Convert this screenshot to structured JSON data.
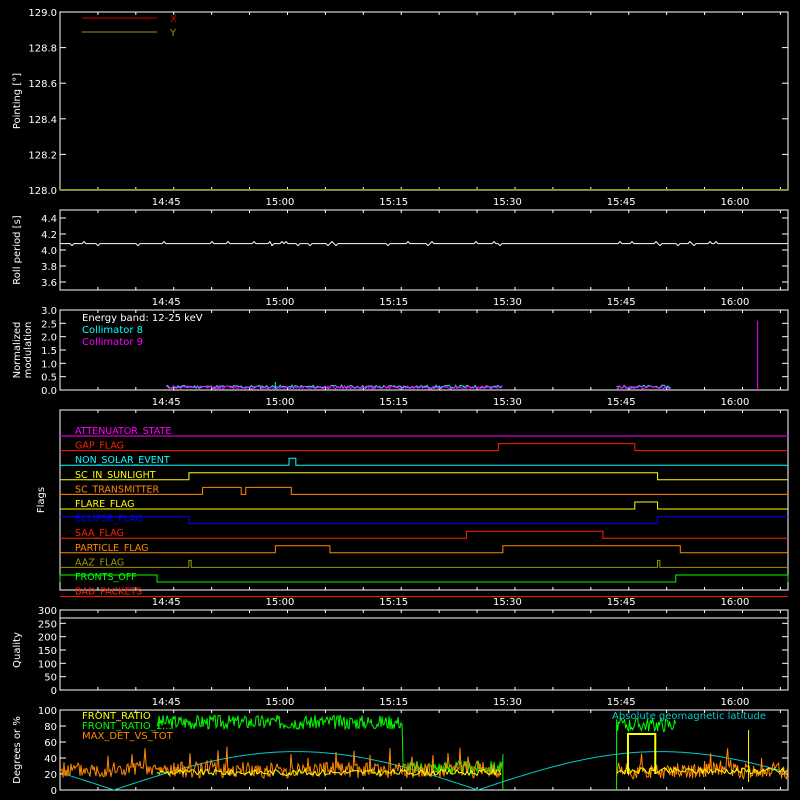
{
  "time_axis": {
    "ticks": [
      "14:45",
      "15:00",
      "15:15",
      "15:30",
      "15:45",
      "16:00"
    ],
    "tick_hours": [
      14.75,
      15.0,
      15.25,
      15.5,
      15.75,
      16.0
    ],
    "range_hours": [
      14.5167,
      16.1167
    ]
  },
  "chart_data": [
    {
      "id": "pointing",
      "type": "line",
      "ylabel": "Pointing [°]",
      "ylim": [
        128.0,
        129.0
      ],
      "yticks": [
        "128.0",
        "128.2",
        "128.4",
        "128.6",
        "128.8",
        "129.0"
      ],
      "ytick_values": [
        128.0,
        128.2,
        128.4,
        128.6,
        128.8,
        129.0
      ],
      "legend": {
        "placement": "top-left"
      },
      "series": [
        {
          "name": "X",
          "color": "#cc0000",
          "values": []
        },
        {
          "name": "Y",
          "color": "#999900",
          "values": []
        }
      ]
    },
    {
      "id": "roll",
      "type": "line",
      "ylabel": "Roll period [s]",
      "ylim": [
        3.5,
        4.5
      ],
      "yticks": [
        "3.6",
        "3.8",
        "4.0",
        "4.2",
        "4.4"
      ],
      "ytick_values": [
        3.6,
        3.8,
        4.0,
        4.2,
        4.4
      ],
      "series": [
        {
          "color": "#ffffff",
          "level": 4.08,
          "segment": [
            14.5167,
            16.1167
          ]
        }
      ]
    },
    {
      "id": "modulation",
      "type": "line",
      "ylabel": [
        "Normalized",
        "modulation"
      ],
      "ylim": [
        0.0,
        3.0
      ],
      "yticks": [
        "0.0",
        "0.5",
        "1.0",
        "1.5",
        "2.0",
        "2.5",
        "3.0"
      ],
      "ytick_values": [
        0.0,
        0.5,
        1.0,
        1.5,
        2.0,
        2.5,
        3.0
      ],
      "legend": {
        "placement": "top-left",
        "header": "Energy band: 12-25 keV"
      },
      "series": [
        {
          "name": "Collimator 8",
          "color": "#00ffff",
          "level": 0.12,
          "segments": [
            [
              14.75,
              15.49
            ],
            [
              15.74,
              15.86
            ]
          ]
        },
        {
          "name": "Collimator 9",
          "color": "#ff00ff",
          "level": 0.1,
          "segments": [
            [
              14.75,
              15.49
            ],
            [
              15.74,
              15.86
            ]
          ],
          "spike": {
            "x": 16.05,
            "value": 2.6
          }
        }
      ]
    },
    {
      "id": "flags",
      "type": "table",
      "ylabel": "Flags",
      "flags": [
        {
          "name": "ATTENUATOR_STATE",
          "color": "#ff00ff",
          "highs": []
        },
        {
          "name": "GAP_FLAG",
          "color": "#ff2200",
          "highs": [
            [
              15.48,
              15.78
            ]
          ]
        },
        {
          "name": "NON_SOLAR_EVENT",
          "color": "#00ffff",
          "highs": [
            [
              15.02,
              15.035
            ]
          ]
        },
        {
          "name": "SC_IN_SUNLIGHT",
          "color": "#ffff00",
          "highs": [
            [
              14.8,
              15.83
            ]
          ]
        },
        {
          "name": "SC_TRANSMITTER",
          "color": "#ff8800",
          "highs": [
            [
              14.83,
              14.915
            ],
            [
              14.925,
              15.025
            ]
          ]
        },
        {
          "name": "FLARE_FLAG",
          "color": "#ffff00",
          "highs": [
            [
              15.78,
              15.83
            ]
          ]
        },
        {
          "name": "ECLIPSE_FLAG",
          "color": "#0000ff",
          "highs": [
            [
              14.5167,
              14.8
            ]
          ],
          "base_high_after": 15.83
        },
        {
          "name": "SAA_FLAG",
          "color": "#ff2200",
          "highs": [
            [
              15.41,
              15.71
            ]
          ]
        },
        {
          "name": "PARTICLE_FLAG",
          "color": "#ff8800",
          "highs": [
            [
              14.99,
              15.11
            ],
            [
              15.49,
              15.88
            ]
          ]
        },
        {
          "name": "AAZ_FLAG",
          "color": "#999900",
          "highs": [
            [
              14.8,
              14.805
            ],
            [
              15.83,
              15.835
            ]
          ]
        },
        {
          "name": "FRONTS_OFF",
          "color": "#00ff00",
          "highs": [
            [
              14.5167,
              14.73
            ],
            [
              15.87,
              16.1167
            ]
          ]
        },
        {
          "name": "BAD_PACKETS",
          "color": "#ff2200",
          "highs": []
        }
      ]
    },
    {
      "id": "quality",
      "type": "line",
      "ylabel": "Quality",
      "ylim": [
        0,
        300
      ],
      "yticks": [
        "0",
        "50",
        "100",
        "150",
        "200",
        "250",
        "300"
      ],
      "ytick_values": [
        0,
        50,
        100,
        150,
        200,
        250,
        300
      ],
      "series": [
        {
          "color": "#ffffff",
          "values": []
        }
      ]
    },
    {
      "id": "ratios",
      "type": "line",
      "ylabel": "Degrees or %",
      "ylim": [
        0,
        100
      ],
      "yticks": [
        "0",
        "20",
        "40",
        "60",
        "80",
        "100"
      ],
      "ytick_values": [
        0,
        20,
        40,
        60,
        80,
        100
      ],
      "annotation": "Absolute geomagnetic latitude",
      "legend": {
        "placement": "top-left"
      },
      "series": [
        {
          "name": "FRONT_RATIO",
          "color": "#ffff00",
          "segments": [
            [
              14.73,
              15.49,
              22
            ],
            [
              15.74,
              16.1167,
              24
            ]
          ],
          "plateau": [
            15.765,
            15.825,
            70
          ]
        },
        {
          "name": "FRONT_RATIO_1...",
          "color": "#00ff00",
          "segments": [
            [
              14.73,
              15.49,
              85
            ],
            [
              15.74,
              15.87,
              82
            ]
          ]
        },
        {
          "name": "MAX_DET_VS_TOT",
          "color": "#ff8800",
          "segments": [
            [
              14.5167,
              15.49,
              25
            ],
            [
              15.74,
              16.1167,
              24
            ]
          ]
        },
        {
          "color": "#00cccc",
          "geomag": {
            "min": 0,
            "max": 48,
            "period_hours": 1.6,
            "phase_hours": 14.635
          }
        }
      ]
    }
  ]
}
